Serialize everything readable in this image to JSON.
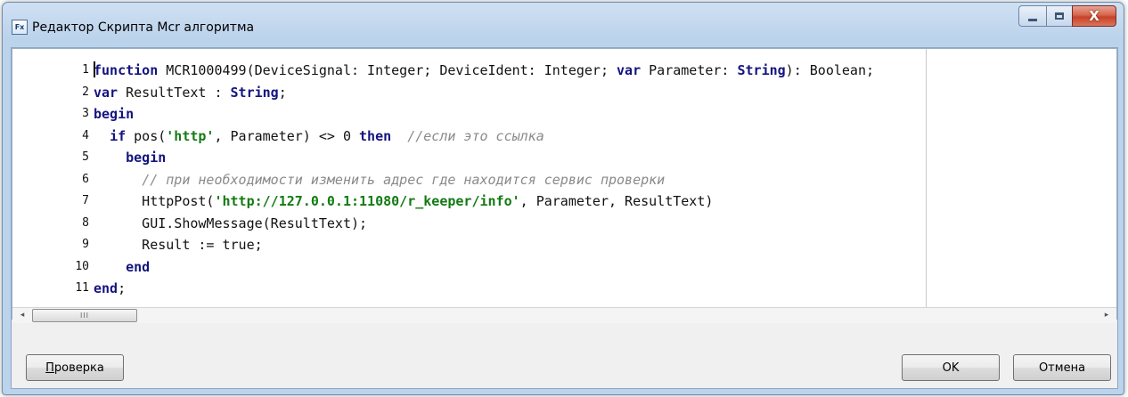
{
  "window": {
    "title": "Редактор Скрипта Mcr алгоритма",
    "icon_label": "Fx",
    "close_glyph": "X"
  },
  "editor": {
    "lines": [
      {
        "num": "1",
        "tokens": [
          [
            "caret",
            ""
          ],
          [
            "kw",
            "function"
          ],
          [
            "plain",
            " MCR1000499(DeviceSignal: Integer; DeviceIdent: Integer; "
          ],
          [
            "kw",
            "var"
          ],
          [
            "plain",
            " Parameter: "
          ],
          [
            "kw",
            "String"
          ],
          [
            "plain",
            "): Boolean;"
          ]
        ]
      },
      {
        "num": "2",
        "tokens": [
          [
            "kw",
            "var"
          ],
          [
            "plain",
            " ResultText : "
          ],
          [
            "kw",
            "String"
          ],
          [
            "plain",
            ";"
          ]
        ]
      },
      {
        "num": "3",
        "tokens": [
          [
            "kw",
            "begin"
          ]
        ]
      },
      {
        "num": "4",
        "tokens": [
          [
            "plain",
            "  "
          ],
          [
            "kw",
            "if"
          ],
          [
            "plain",
            " pos("
          ],
          [
            "str",
            "'http'"
          ],
          [
            "plain",
            ", Parameter) <> 0 "
          ],
          [
            "kw",
            "then"
          ],
          [
            "plain",
            "  "
          ],
          [
            "cmt",
            "//если это ссылка"
          ]
        ]
      },
      {
        "num": "5",
        "tokens": [
          [
            "plain",
            "    "
          ],
          [
            "kw",
            "begin"
          ]
        ]
      },
      {
        "num": "6",
        "tokens": [
          [
            "plain",
            "      "
          ],
          [
            "cmt",
            "// при необходимости изменить адрес где находится сервис проверки"
          ]
        ]
      },
      {
        "num": "7",
        "tokens": [
          [
            "plain",
            "      HttpPost("
          ],
          [
            "str",
            "'http://127.0.0.1:11080/r_keeper/info'"
          ],
          [
            "plain",
            ", Parameter, ResultText)"
          ]
        ]
      },
      {
        "num": "8",
        "tokens": [
          [
            "plain",
            "      GUI.ShowMessage(ResultText);"
          ]
        ]
      },
      {
        "num": "9",
        "tokens": [
          [
            "plain",
            "      Result := true;"
          ]
        ]
      },
      {
        "num": "10",
        "tokens": [
          [
            "plain",
            "    "
          ],
          [
            "kw",
            "end"
          ]
        ]
      },
      {
        "num": "11",
        "tokens": [
          [
            "kw",
            "end"
          ],
          [
            "plain",
            ";"
          ]
        ]
      }
    ]
  },
  "scrollbar": {
    "left_arrow": "◂",
    "right_arrow": "▸",
    "thumb_grip": "III"
  },
  "buttons": {
    "check_underlined": "П",
    "check_rest": "роверка",
    "ok": "OK",
    "cancel": "Отмена"
  },
  "colors": {
    "keyword": "#141480",
    "string": "#137a13",
    "comment": "#8a8a8a",
    "close_button": "#c7412a"
  }
}
